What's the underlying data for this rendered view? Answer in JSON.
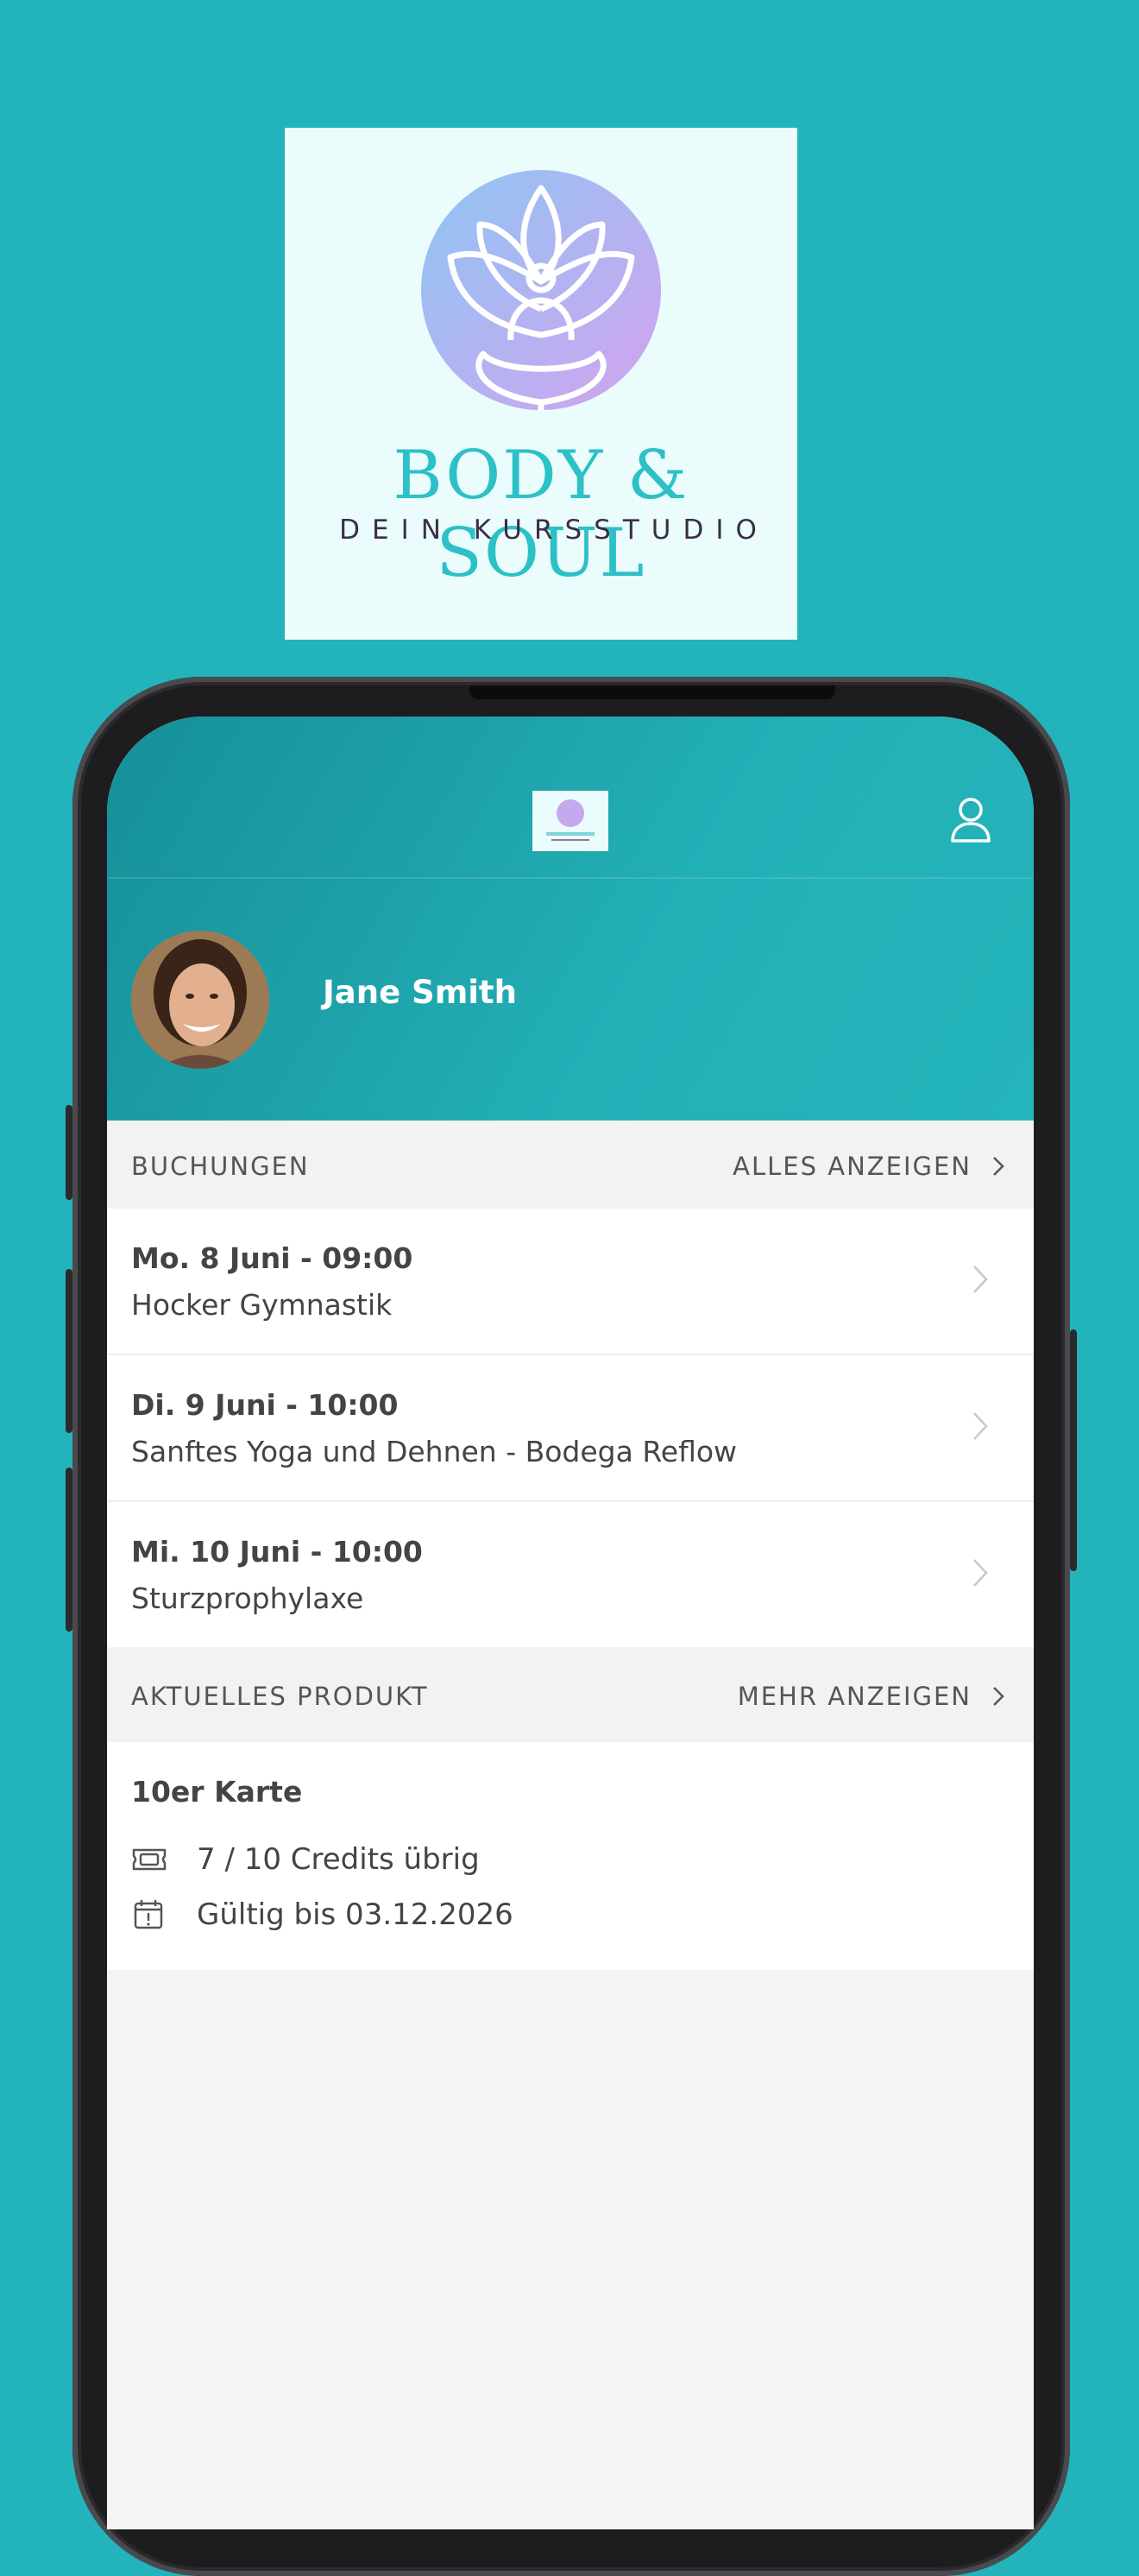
{
  "brand": {
    "name": "BODY & SOUL",
    "tagline": "DEIN KURSSTUDIO",
    "colors": {
      "background": "#23b3bb",
      "accent": "#2cc0c7",
      "header_gradient_start": "#168f98"
    }
  },
  "header": {
    "logo_icon": "body-and-soul-logo",
    "profile_icon": "user-icon"
  },
  "user": {
    "name": "Jane Smith",
    "avatar_icon": "avatar-photo"
  },
  "bookings": {
    "title": "BUCHUNGEN",
    "link_label": "ALLES ANZEIGEN",
    "items": [
      {
        "date": "Mo. 8 Juni - 09:00",
        "course": "Hocker Gymnastik"
      },
      {
        "date": "Di. 9 Juni - 10:00",
        "course": "Sanftes Yoga und Dehnen - Bodega Reflow"
      },
      {
        "date": "Mi. 10 Juni - 10:00",
        "course": "Sturzprophylaxe"
      }
    ]
  },
  "current_product": {
    "title": "AKTUELLES PRODUKT",
    "link_label": "MEHR ANZEIGEN",
    "name": "10er Karte",
    "credits": "7 / 10 Credits übrig",
    "valid_until": "Gültig bis 03.12.2026",
    "credits_icon": "ticket-icon",
    "valid_icon": "calendar-alert-icon"
  }
}
